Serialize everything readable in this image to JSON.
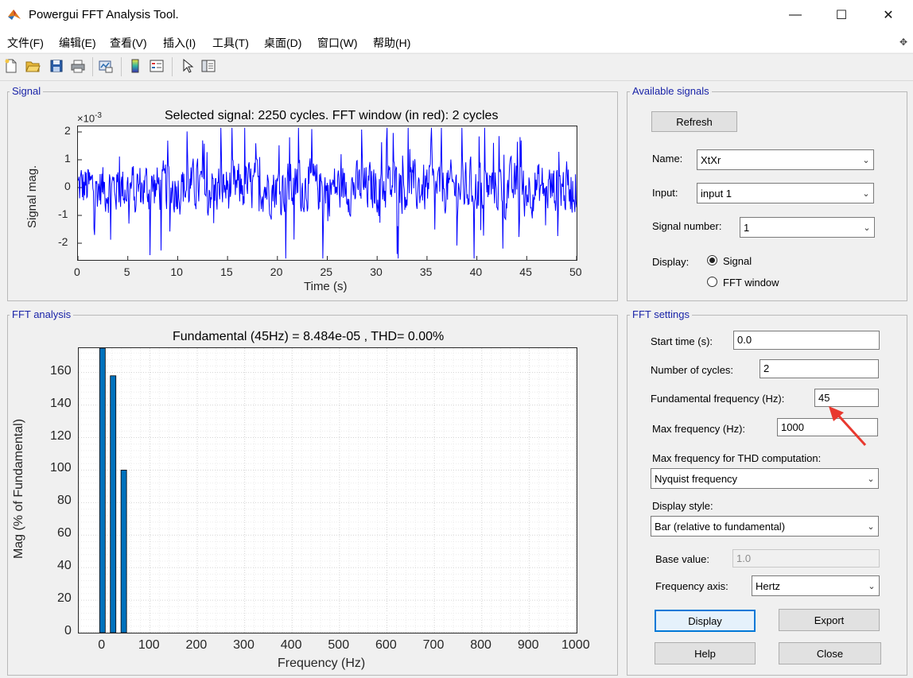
{
  "window": {
    "title": "Powergui FFT Analysis Tool.",
    "controls": {
      "minimize": "—",
      "maximize": "☐",
      "close": "✕"
    }
  },
  "menu": [
    "文件(F)",
    "编辑(E)",
    "查看(V)",
    "插入(I)",
    "工具(T)",
    "桌面(D)",
    "窗口(W)",
    "帮助(H)"
  ],
  "toolbar_icons": [
    "new-file-icon",
    "open-folder-icon",
    "save-icon",
    "print-icon",
    "link-plot-icon",
    "colorbar-icon",
    "legend-icon",
    "pointer-icon",
    "property-inspector-icon"
  ],
  "signal_panel": {
    "title": "Signal",
    "plot_title": "Selected signal: 2250 cycles. FFT window (in red): 2 cycles",
    "ylabel": "Signal mag.",
    "xlabel": "Time (s)",
    "exponent": "×10",
    "exponent_power": "-3",
    "xticks": [
      "0",
      "5",
      "10",
      "15",
      "20",
      "25",
      "30",
      "35",
      "40",
      "45",
      "50"
    ],
    "yticks": [
      "2",
      "1",
      "0",
      "-1",
      "-2"
    ]
  },
  "fft_panel": {
    "title": "FFT analysis",
    "plot_title": "Fundamental (45Hz) = 8.484e-05 , THD= 0.00%",
    "ylabel": "Mag (% of Fundamental)",
    "xlabel": "Frequency (Hz)",
    "xticks": [
      "0",
      "100",
      "200",
      "300",
      "400",
      "500",
      "600",
      "700",
      "800",
      "900",
      "1000"
    ],
    "yticks": [
      "160",
      "140",
      "120",
      "100",
      "80",
      "60",
      "40",
      "20",
      "0"
    ]
  },
  "available_signals": {
    "title": "Available signals",
    "refresh": "Refresh",
    "name_label": "Name:",
    "name_value": "XtXr",
    "input_label": "Input:",
    "input_value": "input 1",
    "signal_number_label": "Signal number:",
    "signal_number_value": "1",
    "display_label": "Display:",
    "display_options": [
      "Signal",
      "FFT window"
    ],
    "display_selected": "Signal"
  },
  "fft_settings": {
    "title": "FFT settings",
    "start_time_label": "Start time (s):",
    "start_time_value": "0.0",
    "cycles_label": "Number of cycles:",
    "cycles_value": "2",
    "fund_freq_label": "Fundamental frequency (Hz):",
    "fund_freq_value": "45",
    "max_freq_label": "Max frequency (Hz):",
    "max_freq_value": "1000",
    "thd_label": "Max frequency for THD computation:",
    "thd_value": "Nyquist frequency",
    "display_style_label": "Display style:",
    "display_style_value": "Bar (relative to fundamental)",
    "base_value_label": "Base value:",
    "base_value": "1.0",
    "freq_axis_label": "Frequency axis:",
    "freq_axis_value": "Hertz",
    "buttons": {
      "display": "Display",
      "export": "Export",
      "help": "Help",
      "close": "Close"
    }
  },
  "colors": {
    "signal_line": "#0000ff",
    "bar_fill": "#0072bd",
    "panel_title": "#1a24a8",
    "annotation_arrow": "#e8392f"
  },
  "chart_data": [
    {
      "type": "line",
      "title": "Selected signal: 2250 cycles. FFT window (in red): 2 cycles",
      "xlabel": "Time (s)",
      "ylabel": "Signal mag.",
      "y_scale_factor": "×10^-3",
      "xlim": [
        0,
        50
      ],
      "ylim": [
        -2.6,
        2.2
      ],
      "grid": false,
      "series": [
        {
          "description": "noisy random signal oscillating roughly between -2.5e-3 and 2.2e-3"
        }
      ]
    },
    {
      "type": "bar",
      "title": "Fundamental (45Hz) = 8.484e-05 , THD= 0.00%",
      "xlabel": "Frequency (Hz)",
      "ylabel": "Mag (% of Fundamental)",
      "xlim": [
        -50,
        1000
      ],
      "ylim": [
        0,
        175
      ],
      "grid": true,
      "x": [
        0,
        22.5,
        45
      ],
      "values": [
        175,
        158,
        100
      ]
    }
  ]
}
